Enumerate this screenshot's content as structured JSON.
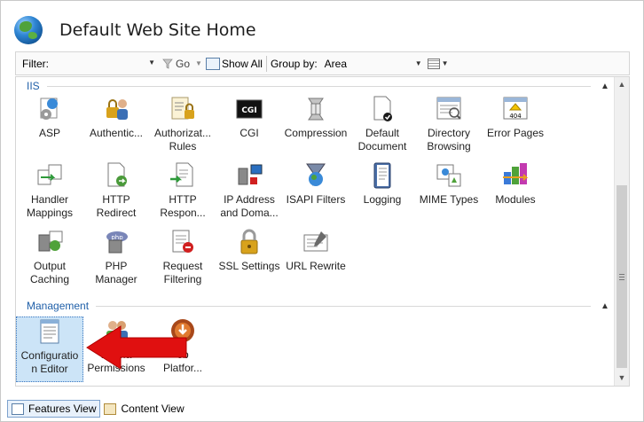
{
  "header": {
    "title": "Default Web Site Home",
    "icon": "globe-icon"
  },
  "toolbar": {
    "filter_label": "Filter:",
    "filter_value": "",
    "go_label": "Go",
    "show_all_label": "Show All",
    "group_by_label": "Group by:",
    "group_by_value": "Area"
  },
  "groups": [
    {
      "name": "IIS",
      "items": [
        {
          "label": "ASP",
          "icon": "asp-icon"
        },
        {
          "label": "Authentic...",
          "icon": "authentication-icon"
        },
        {
          "label": "Authorizat...\nRules",
          "icon": "authorization-rules-icon"
        },
        {
          "label": "CGI",
          "icon": "cgi-icon"
        },
        {
          "label": "Compression",
          "icon": "compression-icon"
        },
        {
          "label": "Default\nDocument",
          "icon": "default-document-icon"
        },
        {
          "label": "Directory\nBrowsing",
          "icon": "directory-browsing-icon"
        },
        {
          "label": "Error Pages",
          "icon": "error-pages-icon"
        },
        {
          "label": "Handler\nMappings",
          "icon": "handler-mappings-icon"
        },
        {
          "label": "HTTP\nRedirect",
          "icon": "http-redirect-icon"
        },
        {
          "label": "HTTP\nRespon...",
          "icon": "http-response-icon"
        },
        {
          "label": "IP Address\nand Doma...",
          "icon": "ip-address-icon"
        },
        {
          "label": "ISAPI Filters",
          "icon": "isapi-filters-icon"
        },
        {
          "label": "Logging",
          "icon": "logging-icon"
        },
        {
          "label": "MIME Types",
          "icon": "mime-types-icon"
        },
        {
          "label": "Modules",
          "icon": "modules-icon"
        },
        {
          "label": "Output\nCaching",
          "icon": "output-caching-icon"
        },
        {
          "label": "PHP\nManager",
          "icon": "php-manager-icon"
        },
        {
          "label": "Request\nFiltering",
          "icon": "request-filtering-icon"
        },
        {
          "label": "SSL Settings",
          "icon": "ssl-settings-icon"
        },
        {
          "label": "URL Rewrite",
          "icon": "url-rewrite-icon"
        }
      ]
    },
    {
      "name": "Management",
      "items": [
        {
          "label": "Configuratio\nn Editor",
          "icon": "configuration-editor-icon",
          "selected": true
        },
        {
          "label": "IIS Ma\nPermissions",
          "icon": "iis-manager-permissions-icon"
        },
        {
          "label": "eb\nPlatfor...",
          "icon": "web-platform-icon"
        }
      ]
    }
  ],
  "statusbar": {
    "features_view_label": "Features View",
    "content_view_label": "Content View"
  },
  "colors": {
    "group_header": "#1f5fa8",
    "selection": "#cce4f7",
    "annotation_arrow": "#e01010"
  }
}
